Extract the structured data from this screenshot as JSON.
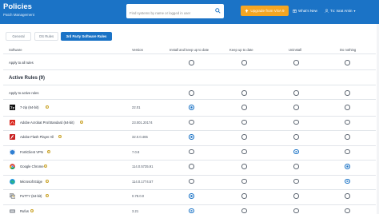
{
  "header": {
    "title": "Policies",
    "subtitle": "Patch Management",
    "search_placeholder": "Find systems by name or logged in user",
    "upgrade_label": "Upgrade from VSA 9",
    "whats_new_label": "What's New",
    "user_label": "Tx: Israt Amin"
  },
  "tabs": [
    {
      "label": "General"
    },
    {
      "label": "OS Rules"
    },
    {
      "label": "3rd Party Software Rules",
      "active": true
    }
  ],
  "columns": {
    "software": "Software",
    "version": "Version",
    "install": "Install and keep up to date",
    "keep": "Keep up to date",
    "uninstall": "Uninstall",
    "nothing": "Do nothing"
  },
  "apply_all": {
    "label": "Apply to all rules"
  },
  "active_rules_heading": "Active Rules (9)",
  "apply_active": {
    "label": "Apply to active rules"
  },
  "rows": [
    {
      "name": "7-zip (64-bit)",
      "version": "22.01",
      "selected": "install",
      "icon": "7zip-icon"
    },
    {
      "name": "Adobe Acrobat Pro/Standard (64-bit)",
      "version": "23.001.20174",
      "selected": "none",
      "icon": "acrobat-icon"
    },
    {
      "name": "Adobe Flash Player All",
      "version": "32.0.0.465",
      "selected": "install",
      "icon": "flash-icon"
    },
    {
      "name": "FortiClient VPN",
      "version": "7.0.8",
      "selected": "uninstall",
      "icon": "forticlient-icon"
    },
    {
      "name": "Google Chrome",
      "version": "114.0.5735.91",
      "selected": "nothing",
      "icon": "chrome-icon"
    },
    {
      "name": "Microsoft Edge",
      "version": "114.0.1774.57",
      "selected": "nothing",
      "icon": "edge-icon"
    },
    {
      "name": "PuTTY (64-bit)",
      "version": "0.78.0.0",
      "selected": "install",
      "icon": "putty-icon"
    },
    {
      "name": "Rufus",
      "version": "3.21",
      "selected": "install",
      "icon": "rufus-icon"
    }
  ],
  "colors": {
    "primary": "#1b73c6",
    "upgrade": "#f5a623"
  }
}
